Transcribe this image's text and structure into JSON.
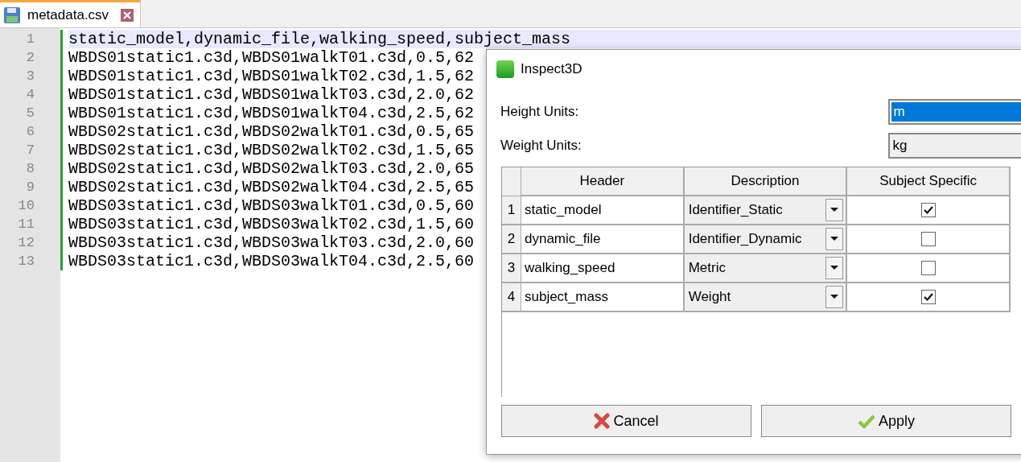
{
  "editor": {
    "tab": {
      "label": "metadata.csv",
      "selected": true
    },
    "lines": [
      {
        "number": "1",
        "text": "static_model,dynamic_file,walking_speed,subject_mass",
        "current": true
      },
      {
        "number": "2",
        "text": "WBDS01static1.c3d,WBDS01walkT01.c3d,0.5,62",
        "current": false
      },
      {
        "number": "3",
        "text": "WBDS01static1.c3d,WBDS01walkT02.c3d,1.5,62",
        "current": false
      },
      {
        "number": "4",
        "text": "WBDS01static1.c3d,WBDS01walkT03.c3d,2.0,62",
        "current": false
      },
      {
        "number": "5",
        "text": "WBDS01static1.c3d,WBDS01walkT04.c3d,2.5,62",
        "current": false
      },
      {
        "number": "6",
        "text": "WBDS02static1.c3d,WBDS02walkT01.c3d,0.5,65",
        "current": false
      },
      {
        "number": "7",
        "text": "WBDS02static1.c3d,WBDS02walkT02.c3d,1.5,65",
        "current": false
      },
      {
        "number": "8",
        "text": "WBDS02static1.c3d,WBDS02walkT03.c3d,2.0,65",
        "current": false
      },
      {
        "number": "9",
        "text": "WBDS02static1.c3d,WBDS02walkT04.c3d,2.5,65",
        "current": false
      },
      {
        "number": "10",
        "text": "WBDS03static1.c3d,WBDS03walkT01.c3d,0.5,60",
        "current": false
      },
      {
        "number": "11",
        "text": "WBDS03static1.c3d,WBDS03walkT02.c3d,1.5,60",
        "current": false
      },
      {
        "number": "12",
        "text": "WBDS03static1.c3d,WBDS03walkT03.c3d,2.0,60",
        "current": false
      },
      {
        "number": "13",
        "text": "WBDS03static1.c3d,WBDS03walkT04.c3d,2.5,60",
        "current": false
      }
    ]
  },
  "dialog": {
    "title": "Inspect3D",
    "fields": [
      {
        "label": "Height Units:",
        "value": "m",
        "kind": "text",
        "focused": true
      },
      {
        "label": "Weight Units:",
        "value": "kg",
        "kind": "combo",
        "focused": false
      }
    ],
    "table": {
      "columns": [
        "Header",
        "Description",
        "Subject Specific"
      ],
      "rows": [
        {
          "number": "1",
          "header": "static_model",
          "description": "Identifier_Static",
          "checked": true
        },
        {
          "number": "2",
          "header": "dynamic_file",
          "description": "Identifier_Dynamic",
          "checked": false
        },
        {
          "number": "3",
          "header": "walking_speed",
          "description": "Metric",
          "checked": false
        },
        {
          "number": "4",
          "header": "subject_mass",
          "description": "Weight",
          "checked": true
        }
      ]
    },
    "buttons": [
      {
        "label": "Cancel",
        "kind": "cancel"
      },
      {
        "label": "Apply",
        "kind": "apply"
      }
    ]
  }
}
